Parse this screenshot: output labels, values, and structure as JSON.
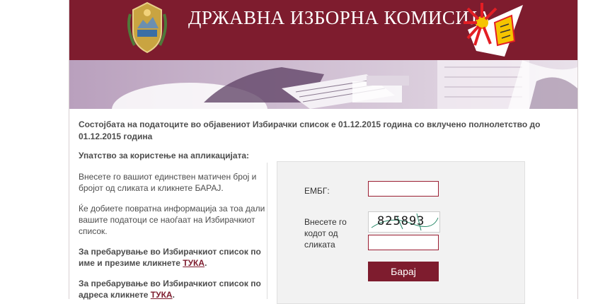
{
  "header": {
    "title": "ДРЖАВНА ИЗБОРНА КОМИСИЈА",
    "background_color": "#7e1c2e"
  },
  "intro": {
    "text": "Состојбата на податоците во објавениот Избирачки список е 01.12.2015 година со вклучено полнолетство до 01.12.2015 година"
  },
  "guide": {
    "title": "Упатство за користење на апликацијата:",
    "p1": "Внесете го вашиот единствен матичен број и бројот од сликата и кликнете БАРАЈ.",
    "p2": "Ќе добиете повратна информација за тоа дали вашите податоци се наоѓаат на Избирачкиот список.",
    "p3_text": "За пребарување во Избирачкиот список по име и презиме кликнете ",
    "p3_link": "ТУКА",
    "p4_text": "За пребарување во Избирачкиот  список по адреса кликнете ",
    "p4_link": "ТУКА",
    "period": "."
  },
  "form": {
    "embg_label": "ЕМБГ:",
    "embg_value": "",
    "code_label": "Внесете го кодот од сликата",
    "captcha_text": "825893",
    "code_value": "",
    "submit_label": "Барај",
    "accent_color": "#7e1c2e"
  }
}
